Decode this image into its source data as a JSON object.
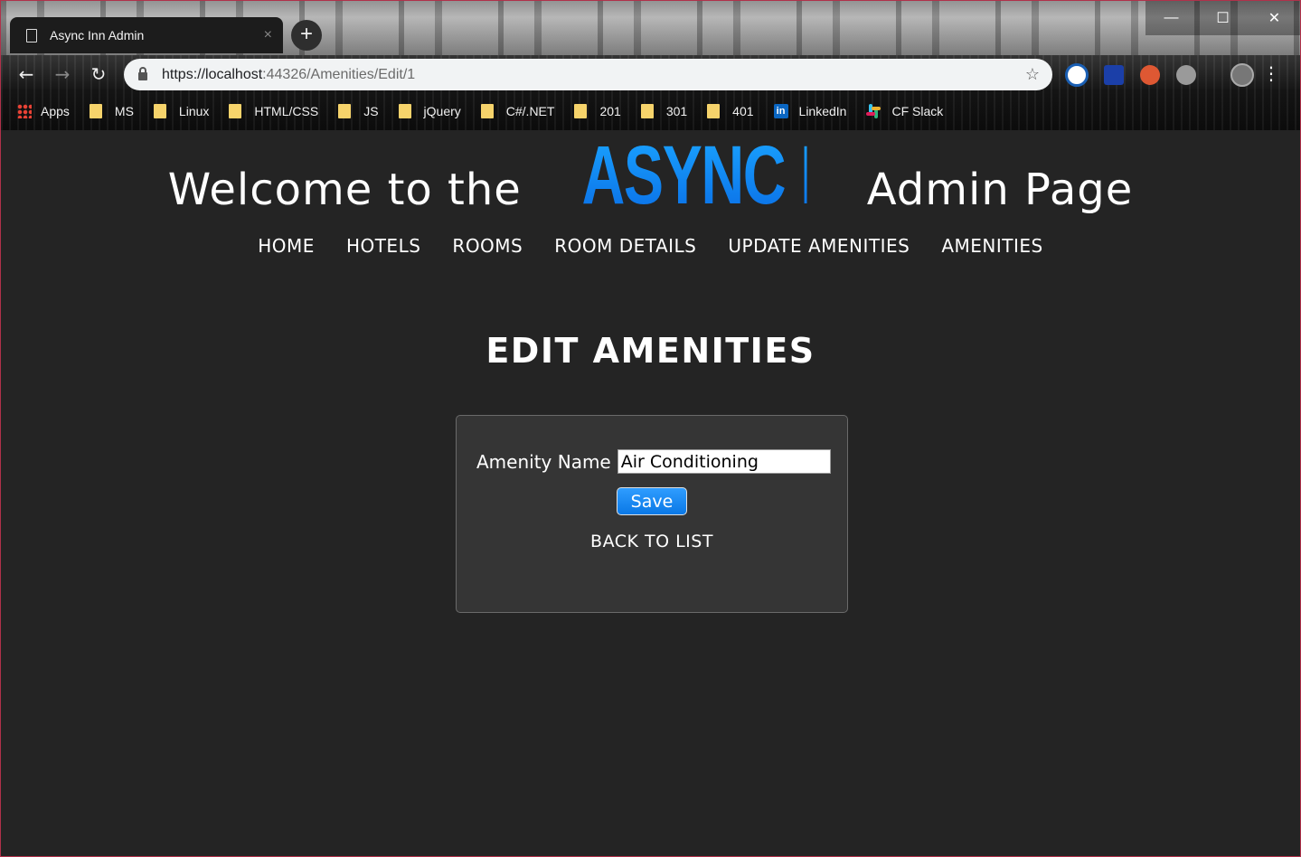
{
  "browser": {
    "tab_title": "Async Inn Admin",
    "tab_close": "×",
    "new_tab": "+",
    "url_host": "https://localhost",
    "url_path": ":44326/Amenities/Edit/1",
    "window_controls": {
      "minimize": "—",
      "maximize": "☐",
      "close": "✕"
    },
    "nav": {
      "back": "←",
      "forward": "→",
      "reload": "↻"
    },
    "star": "☆",
    "menu": "⋮",
    "bookmarks": [
      {
        "label": "Apps",
        "icon": "apps-grid-icon"
      },
      {
        "label": "MS",
        "icon": "folder-icon"
      },
      {
        "label": "Linux",
        "icon": "folder-icon"
      },
      {
        "label": "HTML/CSS",
        "icon": "folder-icon"
      },
      {
        "label": "JS",
        "icon": "folder-icon"
      },
      {
        "label": "jQuery",
        "icon": "folder-icon"
      },
      {
        "label": "C#/.NET",
        "icon": "folder-icon"
      },
      {
        "label": "201",
        "icon": "folder-icon"
      },
      {
        "label": "301",
        "icon": "folder-icon"
      },
      {
        "label": "401",
        "icon": "folder-icon"
      },
      {
        "label": "LinkedIn",
        "icon": "linkedin-icon"
      },
      {
        "label": "CF Slack",
        "icon": "slack-icon"
      }
    ]
  },
  "header": {
    "welcome_prefix": "Welcome to the",
    "brand": "ASYNC INN",
    "welcome_suffix": "Admin Page",
    "brand_color": "#1a8cff"
  },
  "nav": {
    "home": "HOME",
    "hotels": "HOTELS",
    "rooms": "ROOMS",
    "room_details": "ROOM DETAILS",
    "update_amenities": "UPDATE AMENITIES",
    "amenities": "AMENITIES"
  },
  "main": {
    "title": "EDIT AMENITIES",
    "form": {
      "label": "Amenity Name",
      "value": "Air Conditioning",
      "save": "Save",
      "back": "BACK TO LIST"
    }
  },
  "colors": {
    "page_bg": "#242424",
    "card_bg": "#353535",
    "button": "#0a78e6"
  }
}
